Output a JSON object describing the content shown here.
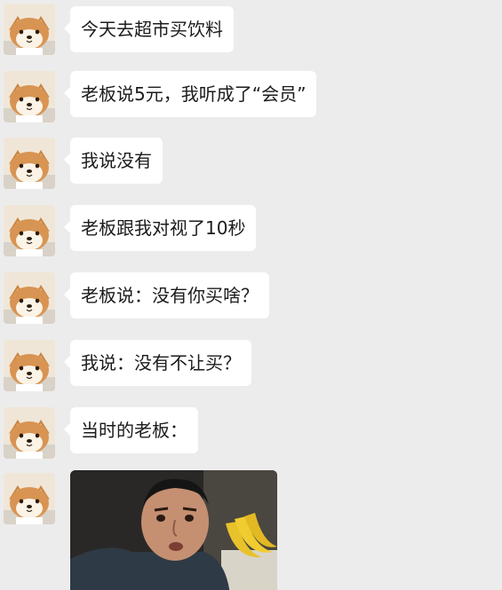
{
  "chat": {
    "messages": [
      {
        "text": "今天去超市买饮料"
      },
      {
        "text": "老板说5元，我听成了“会员”"
      },
      {
        "text": "我说没有"
      },
      {
        "text": "老板跟我对视了10秒"
      },
      {
        "text": "老板说：没有你买啥？"
      },
      {
        "text": "我说：没有不让买？"
      },
      {
        "text": "当时的老板："
      }
    ],
    "image_message": {
      "description_icon": "man-with-bananas-photo"
    }
  },
  "colors": {
    "background": "#ececec",
    "bubble": "#ffffff",
    "text": "#1b1b1b"
  }
}
